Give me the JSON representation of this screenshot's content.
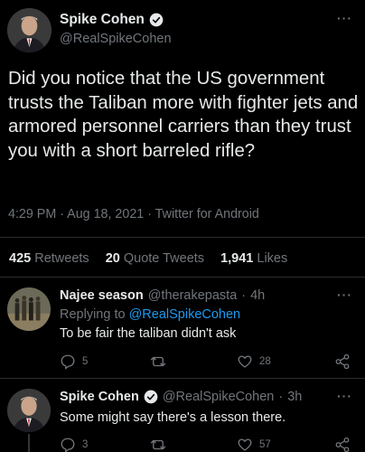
{
  "main_tweet": {
    "author_name": "Spike Cohen",
    "author_handle": "@RealSpikeCohen",
    "text": "Did you notice that the US government trusts the Taliban more with fighter jets and armored personnel carriers than they trust you with a short barreled rifle?",
    "time": "4:29 PM",
    "date": "Aug 18, 2021",
    "source": "Twitter for Android",
    "meta_line": "4:29 PM · Aug 18, 2021 · Twitter for Android",
    "more_label": "···",
    "stats": {
      "retweets_count": "425",
      "retweets_label": "Retweets",
      "quotes_count": "20",
      "quotes_label": "Quote Tweets",
      "likes_count": "1,941",
      "likes_label": "Likes"
    }
  },
  "replies": [
    {
      "name": "Najee season",
      "handle": "@therakepasta",
      "sep": "·",
      "age": "4h",
      "replying_prefix": "Replying to",
      "replying_to": "@RealSpikeCohen",
      "text": "To be fair the taliban didn't ask",
      "more_label": "···",
      "reply_count": "5",
      "retweet_count": "",
      "like_count": "28"
    },
    {
      "name": "Spike Cohen",
      "handle": "@RealSpikeCohen",
      "sep": "·",
      "age": "3h",
      "text": "Some might say there's a lesson there.",
      "more_label": "···",
      "reply_count": "3",
      "retweet_count": "",
      "like_count": "57"
    }
  ],
  "colors": {
    "background": "#000000",
    "text": "#e7e9ea",
    "muted": "#71767b",
    "link": "#1d9bf0",
    "verified": "#1d9bf0",
    "divider": "#2a2d30"
  },
  "icons": [
    "verified-badge-icon",
    "more-icon",
    "reply-icon",
    "retweet-icon",
    "like-icon",
    "share-icon"
  ]
}
